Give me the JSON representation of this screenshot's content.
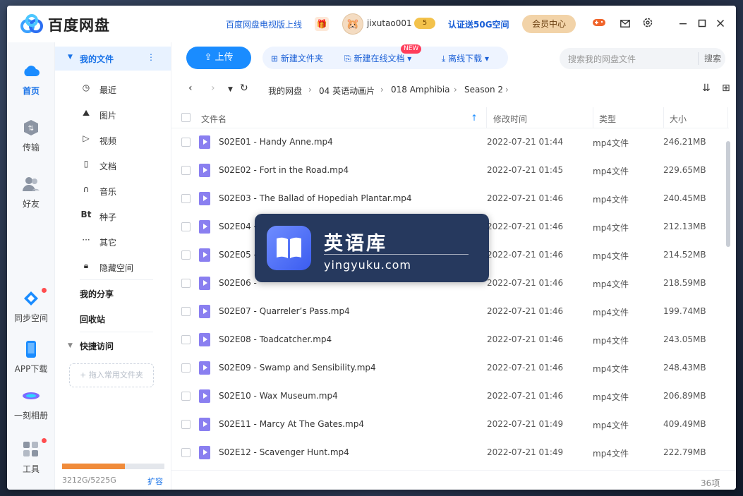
{
  "app": {
    "title": "百度网盘",
    "tv_notice": "百度网盘电视版上线",
    "username": "jixutao001",
    "vip_level": "5",
    "cert_link": "认证送50G空间",
    "member_center": "会员中心",
    "window_controls": [
      "minimize-icon",
      "maximize-icon",
      "close-icon"
    ]
  },
  "rail": {
    "items": [
      {
        "label": "首页",
        "icon": "cloud-home-icon"
      },
      {
        "label": "传输",
        "icon": "transfer-icon"
      },
      {
        "label": "好友",
        "icon": "friends-icon"
      },
      {
        "label": "同步空间",
        "icon": "sync-space-icon"
      },
      {
        "label": "APP下载",
        "icon": "phone-icon"
      },
      {
        "label": "一刻相册",
        "icon": "album-icon"
      },
      {
        "label": "工具",
        "icon": "tools-icon"
      }
    ]
  },
  "sidebar": {
    "my_files": "我的文件",
    "items": [
      {
        "label": "最近",
        "icon": "clock-icon"
      },
      {
        "label": "图片",
        "icon": "image-icon"
      },
      {
        "label": "视频",
        "icon": "video-icon"
      },
      {
        "label": "文档",
        "icon": "document-icon"
      },
      {
        "label": "音乐",
        "icon": "headphones-icon"
      },
      {
        "label": "种子",
        "icon": "bt-icon"
      },
      {
        "label": "其它",
        "icon": "more-icon"
      },
      {
        "label": "隐藏空间",
        "icon": "lock-icon"
      }
    ],
    "my_share": "我的分享",
    "recycle": "回收站",
    "quick_access": "快捷访问",
    "drop_hint": "+ 拖入常用文件夹",
    "quota_text": "3212G/5225G",
    "quota_fraction": 0.615,
    "expand": "扩容"
  },
  "toolbar": {
    "upload": "上传",
    "new_folder": "新建文件夹",
    "new_online_doc": "新建在线文档",
    "new_badge": "NEW",
    "offline_download": "离线下载",
    "search_placeholder": "搜索我的网盘文件",
    "search_button": "搜索"
  },
  "breadcrumb": [
    "我的网盘",
    "04 英语动画片",
    "018 Amphibia",
    "Season 2"
  ],
  "table": {
    "headers": {
      "name": "文件名",
      "modified": "修改时间",
      "type": "类型",
      "size": "大小"
    },
    "rows": [
      {
        "name": "S02E01 - Handy Anne.mp4",
        "modified": "2022-07-21 01:44",
        "type": "mp4文件",
        "size": "246.21MB"
      },
      {
        "name": "S02E02 - Fort in the Road.mp4",
        "modified": "2022-07-21 01:45",
        "type": "mp4文件",
        "size": "229.65MB"
      },
      {
        "name": "S02E03 - The Ballad of Hopediah Plantar.mp4",
        "modified": "2022-07-21 01:46",
        "type": "mp4文件",
        "size": "240.45MB"
      },
      {
        "name": "S02E04 -",
        "modified": "2022-07-21 01:46",
        "type": "mp4文件",
        "size": "212.13MB"
      },
      {
        "name": "S02E05 -",
        "modified": "2022-07-21 01:46",
        "type": "mp4文件",
        "size": "214.52MB"
      },
      {
        "name": "S02E06 -",
        "modified": "2022-07-21 01:46",
        "type": "mp4文件",
        "size": "218.59MB"
      },
      {
        "name": "S02E07 - Quarreler’s Pass.mp4",
        "modified": "2022-07-21 01:46",
        "type": "mp4文件",
        "size": "199.74MB"
      },
      {
        "name": "S02E08 - Toadcatcher.mp4",
        "modified": "2022-07-21 01:46",
        "type": "mp4文件",
        "size": "243.05MB"
      },
      {
        "name": "S02E09 - Swamp and Sensibility.mp4",
        "modified": "2022-07-21 01:46",
        "type": "mp4文件",
        "size": "248.43MB"
      },
      {
        "name": "S02E10 - Wax Museum.mp4",
        "modified": "2022-07-21 01:46",
        "type": "mp4文件",
        "size": "206.89MB"
      },
      {
        "name": "S02E11 - Marcy At The Gates.mp4",
        "modified": "2022-07-21 01:49",
        "type": "mp4文件",
        "size": "409.49MB"
      },
      {
        "name": "S02E12 - Scavenger Hunt.mp4",
        "modified": "2022-07-21 01:49",
        "type": "mp4文件",
        "size": "222.79MB"
      }
    ],
    "count": "36项"
  },
  "watermark": {
    "title": "英语库",
    "url": "yingyuku.com"
  },
  "colors": {
    "accent": "#1a8cff",
    "link": "#1a5fd6",
    "file_icon": "#8a7ff0",
    "quota_fill": "#f08b3a"
  }
}
